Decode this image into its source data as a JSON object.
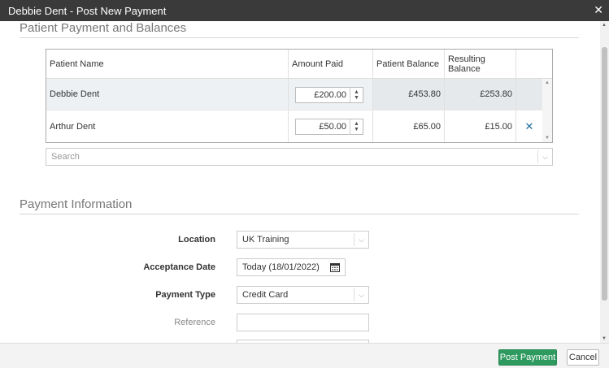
{
  "window": {
    "title": "Debbie Dent - Post New Payment"
  },
  "icons": {
    "close": "close-icon",
    "remove": "remove-row-icon",
    "calendar": "calendar-icon",
    "chevron": "chevron-down-icon"
  },
  "colors": {
    "accent": "#2e9a5f",
    "titlebar": "#3a3a3a",
    "link": "#1f6f9e"
  },
  "balances": {
    "title": "Patient Payment and Balances",
    "columns": [
      "Patient Name",
      "Amount Paid",
      "Patient Balance",
      "Resulting Balance"
    ],
    "rows": [
      {
        "name": "Debbie Dent",
        "amount": "£200.00",
        "patient_balance": "£453.80",
        "resulting_balance": "£253.80"
      },
      {
        "name": "Arthur Dent",
        "amount": "£50.00",
        "patient_balance": "£65.00",
        "resulting_balance": "£15.00"
      }
    ],
    "search_placeholder": "Search"
  },
  "payment_info": {
    "title": "Payment Information",
    "location": {
      "label": "Location",
      "value": "UK Training"
    },
    "acceptance_date": {
      "label": "Acceptance Date",
      "value": "Today (18/01/2022)"
    },
    "payment_type": {
      "label": "Payment Type",
      "value": "Credit Card"
    },
    "reference": {
      "label": "Reference",
      "value": ""
    }
  },
  "footer": {
    "post_label": "Post Payment",
    "cancel_label": "Cancel"
  }
}
